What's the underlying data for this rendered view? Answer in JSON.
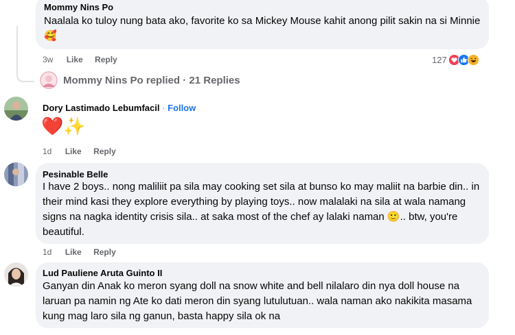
{
  "comments": [
    {
      "author": "Mommy Nins Po",
      "text": "Naalala ko tuloy nung bata ako, favorite ko sa Mickey Mouse kahit anong pilit sakin na si Minnie",
      "emoji": "🥰",
      "time": "3w",
      "like": "Like",
      "reply": "Reply",
      "reaction_count": "127",
      "reactions": [
        "heart-reaction",
        "like-reaction",
        "haha-reaction"
      ],
      "replies_summary": {
        "author": "Mommy Nins Po",
        "verb": "replied",
        "sep": "·",
        "count": "21 Replies"
      }
    },
    {
      "author": "Dory Lastimado Lebumfacil",
      "sep": "·",
      "follow": "Follow",
      "emoji": "❤️✨",
      "time": "1d",
      "like": "Like",
      "reply": "Reply"
    },
    {
      "author": "Pesinable Belle",
      "text": "I have 2 boys.. nong maliliit pa sila may cooking set sila at bunso ko may maliit na barbie din.. in their mind kasi they explore everything by playing toys.. now malalaki na sila at wala namang signs na nagka identity crisis sila.. at saka most of the chef ay lalaki naman",
      "emoji": "🙂",
      "text_after": ".. btw, you're beautiful.",
      "time": "1d",
      "like": "Like",
      "reply": "Reply"
    },
    {
      "author": "Lud Pauliene Aruta Guinto II",
      "text": "Ganyan din Anak ko meron syang doll na snow white and bell nilalaro din nya doll house na laruan pa namin ng Ate ko dati meron din syang lutulutuan.. wala naman ako nakikita masama kung mag laro sila ng ganun, basta happy sila ok na"
    }
  ],
  "colors": {
    "bubble": "#f0f2f5",
    "meta": "#65676b",
    "link": "#1b74e4",
    "text": "#050505"
  }
}
